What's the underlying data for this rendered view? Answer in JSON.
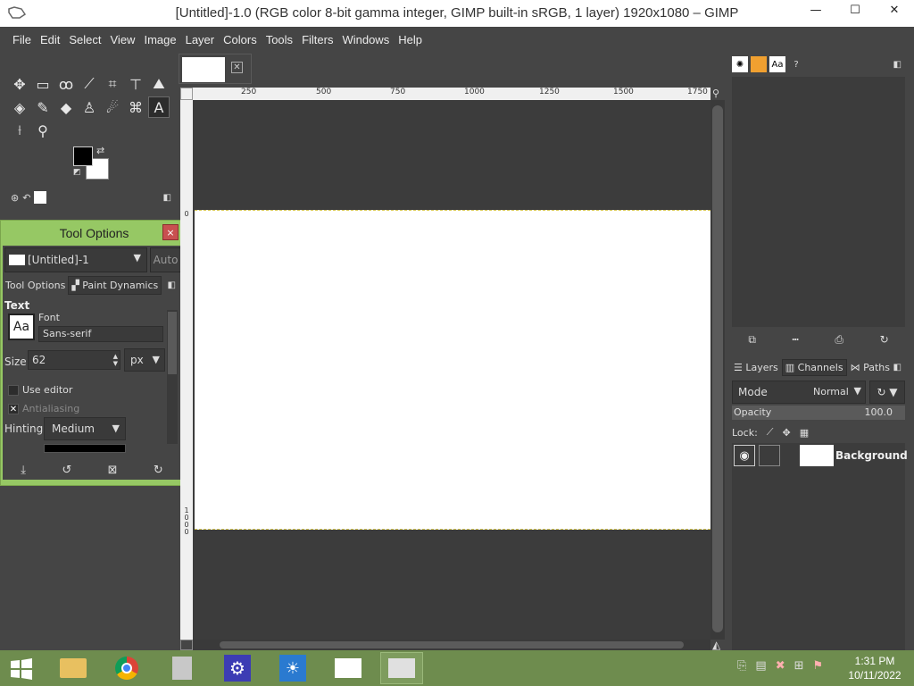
{
  "window": {
    "title": "[Untitled]-1.0 (RGB color 8-bit gamma integer, GIMP built-in sRGB, 1 layer) 1920x1080 – GIMP",
    "minimize": "—",
    "maximize": "☐",
    "close": "✕"
  },
  "menu": [
    "File",
    "Edit",
    "Select",
    "View",
    "Image",
    "Layer",
    "Colors",
    "Tools",
    "Filters",
    "Windows",
    "Help"
  ],
  "toolbox": {
    "swap_glyph": "⇄",
    "reset_glyph": "◩"
  },
  "tool_options": {
    "title": "Tool Options",
    "close": "×",
    "image_name": "[Untitled]-1",
    "auto": "Auto",
    "tab_tool_options": "Tool Options",
    "tab_paint_dynamics": "Paint Dynamics",
    "section": "Text",
    "font_label": "Font",
    "font_value": "Sans-serif",
    "font_preview": "Aa",
    "size_label": "Size:",
    "size_value": "62",
    "unit": "px",
    "use_editor_label": "Use editor",
    "use_editor_checked": false,
    "antialiasing_label": "Antialiasing",
    "antialiasing_checked": true,
    "hinting_label": "Hinting:",
    "hinting_value": "Medium",
    "footer": [
      "⤓",
      "↺",
      "⊠",
      "↻"
    ]
  },
  "ruler": {
    "h_marks": [
      "250",
      "500",
      "750",
      "1000",
      "1250",
      "1500",
      "1750"
    ],
    "v_marks": [
      "0",
      "1\n0\n0\n0"
    ]
  },
  "dock": {
    "layers_tab": "Layers",
    "channels_tab": "Channels",
    "paths_tab": "Paths",
    "mode_label": "Mode",
    "mode_value": "Normal",
    "opacity_label": "Opacity",
    "opacity_value": "100.0",
    "lock_label": "Lock:",
    "layer_name": "Background",
    "brush_btns": [
      "⧉",
      "┅",
      "⎙",
      "↻"
    ]
  },
  "taskbar": {
    "time": "1:31 PM",
    "date": "10/11/2022"
  }
}
